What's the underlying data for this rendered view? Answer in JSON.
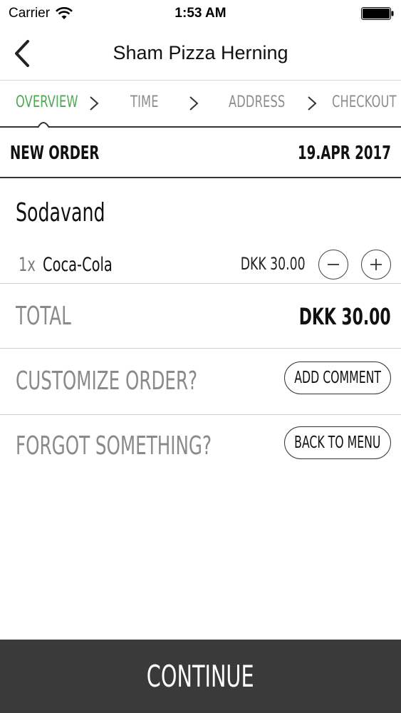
{
  "status_bar": {
    "carrier": "Carrier",
    "time": "1:53 AM"
  },
  "nav": {
    "title": "Sham Pizza Herning",
    "back_icon": "chevron-left-icon"
  },
  "steps": [
    {
      "label": "OVERVIEW",
      "active": true
    },
    {
      "label": "TIME",
      "active": false
    },
    {
      "label": "ADDRESS",
      "active": false
    },
    {
      "label": "CHECKOUT",
      "active": false
    }
  ],
  "order": {
    "label": "NEW ORDER",
    "date": "19.APR 2017"
  },
  "category": "Sodavand",
  "items": [
    {
      "qty": "1x",
      "name": "Coca-Cola",
      "price": "DKK 30.00"
    }
  ],
  "total": {
    "label": "TOTAL",
    "value": "DKK 30.00"
  },
  "customize": {
    "label": "CUSTOMIZE ORDER?",
    "button": "ADD COMMENT"
  },
  "forgot": {
    "label": "FORGOT SOMETHING?",
    "button": "BACK TO MENU"
  },
  "continue_label": "CONTINUE",
  "colors": {
    "active_step": "#4ea852",
    "inactive_step": "#8d8d8d",
    "continue_bg": "#3b3a3b"
  }
}
